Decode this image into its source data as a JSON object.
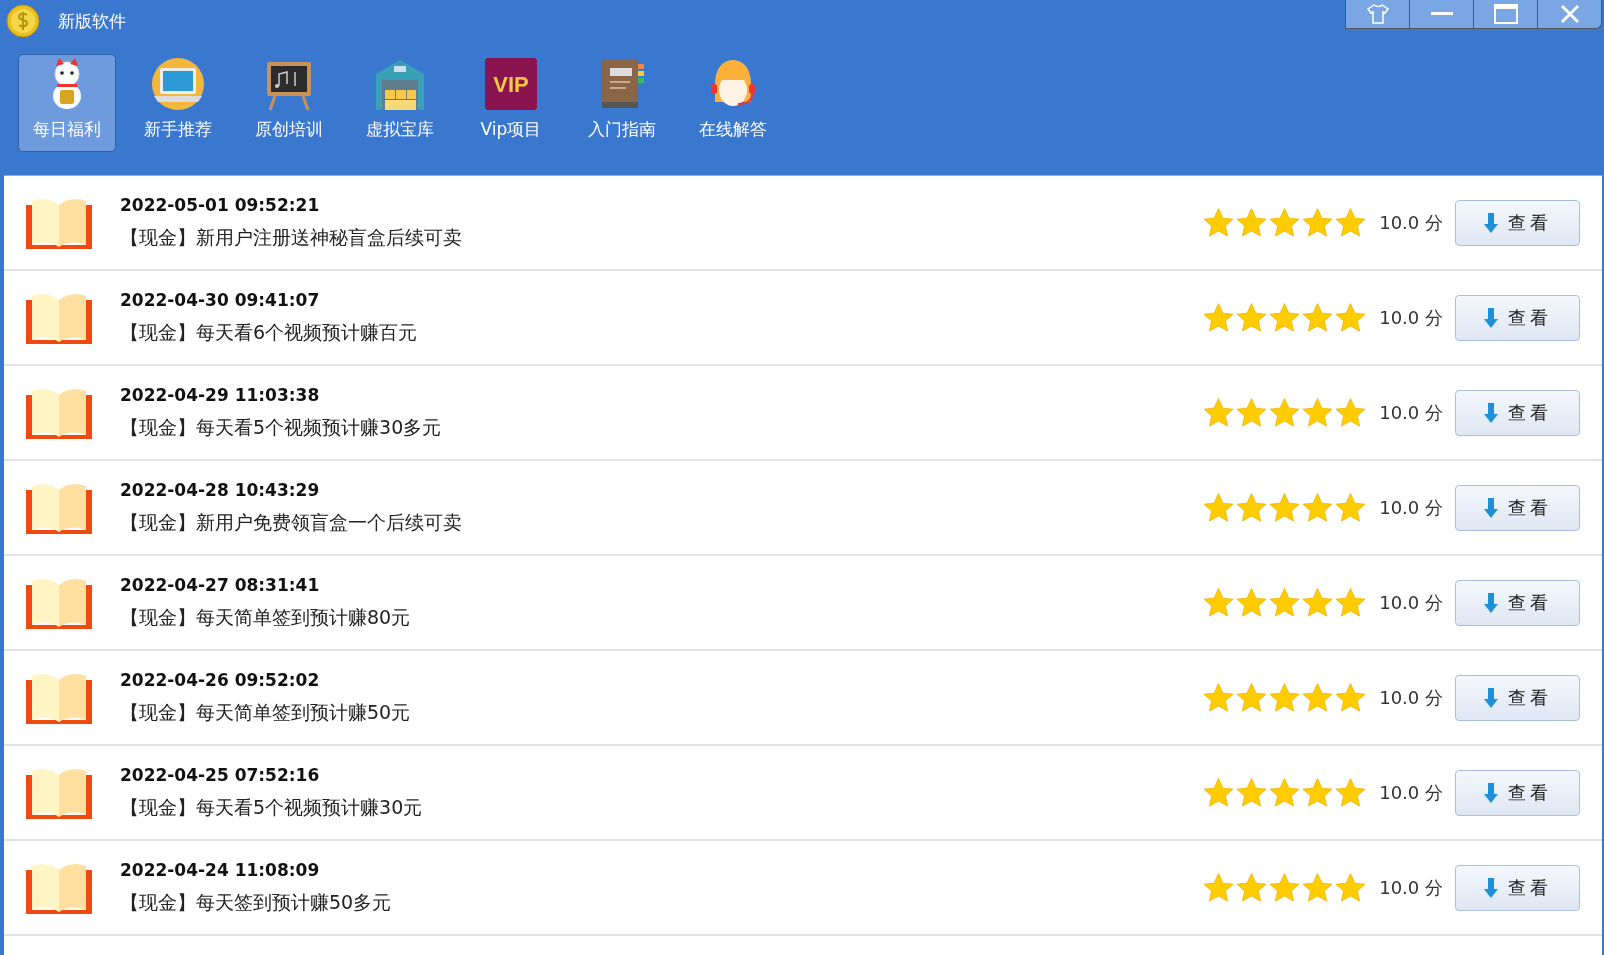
{
  "window": {
    "title": "新版软件"
  },
  "nav": [
    {
      "label": "每日福利",
      "selected": true,
      "kind": "cat"
    },
    {
      "label": "新手推荐",
      "selected": false,
      "kind": "laptop"
    },
    {
      "label": "原创培训",
      "selected": false,
      "kind": "board"
    },
    {
      "label": "虚拟宝库",
      "selected": false,
      "kind": "warehouse"
    },
    {
      "label": "Vip项目",
      "selected": false,
      "kind": "vip",
      "badge": "VIP"
    },
    {
      "label": "入门指南",
      "selected": false,
      "kind": "book"
    },
    {
      "label": "在线解答",
      "selected": false,
      "kind": "support"
    }
  ],
  "rows": [
    {
      "time": "2022-05-01 09:52:21",
      "title": "【现金】新用户注册送神秘盲盒后续可卖",
      "stars": 5,
      "score": "10.0 分",
      "button": "查看"
    },
    {
      "time": "2022-04-30 09:41:07",
      "title": "【现金】每天看6个视频预计赚百元",
      "stars": 5,
      "score": "10.0 分",
      "button": "查看"
    },
    {
      "time": "2022-04-29 11:03:38",
      "title": "【现金】每天看5个视频预计赚30多元",
      "stars": 5,
      "score": "10.0 分",
      "button": "查看"
    },
    {
      "time": "2022-04-28 10:43:29",
      "title": "【现金】新用户免费领盲盒一个后续可卖",
      "stars": 5,
      "score": "10.0 分",
      "button": "查看"
    },
    {
      "time": "2022-04-27 08:31:41",
      "title": "【现金】每天简单签到预计赚80元",
      "stars": 5,
      "score": "10.0 分",
      "button": "查看"
    },
    {
      "time": "2022-04-26 09:52:02",
      "title": "【现金】每天简单签到预计赚50元",
      "stars": 5,
      "score": "10.0 分",
      "button": "查看"
    },
    {
      "time": "2022-04-25 07:52:16",
      "title": "【现金】每天看5个视频预计赚30元",
      "stars": 5,
      "score": "10.0 分",
      "button": "查看"
    },
    {
      "time": "2022-04-24 11:08:09",
      "title": "【现金】每天签到预计赚50多元",
      "stars": 5,
      "score": "10.0 分",
      "button": "查看"
    }
  ]
}
